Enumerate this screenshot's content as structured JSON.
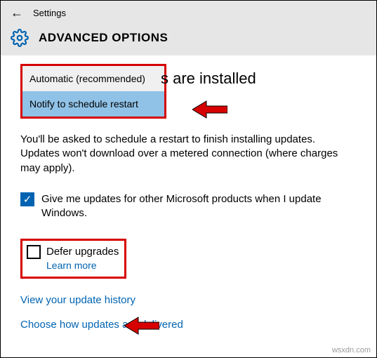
{
  "header": {
    "settings_label": "Settings",
    "page_title": "ADVANCED OPTIONS"
  },
  "dropdown": {
    "heading_fragment": "s are installed",
    "options": [
      {
        "label": "Automatic (recommended)",
        "selected": false
      },
      {
        "label": "Notify to schedule restart",
        "selected": true
      }
    ]
  },
  "description": "You'll be asked to schedule a restart to finish installing updates. Updates won't download over a metered connection (where charges may apply).",
  "checkboxes": {
    "other_products": {
      "label": "Give me updates for other Microsoft products when I update Windows.",
      "checked": true
    },
    "defer": {
      "label": "Defer upgrades",
      "checked": false,
      "learn_more": "Learn more"
    }
  },
  "links": {
    "history": "View your update history",
    "delivery": "Choose how updates are delivered"
  },
  "watermark": "wsxdn.com"
}
